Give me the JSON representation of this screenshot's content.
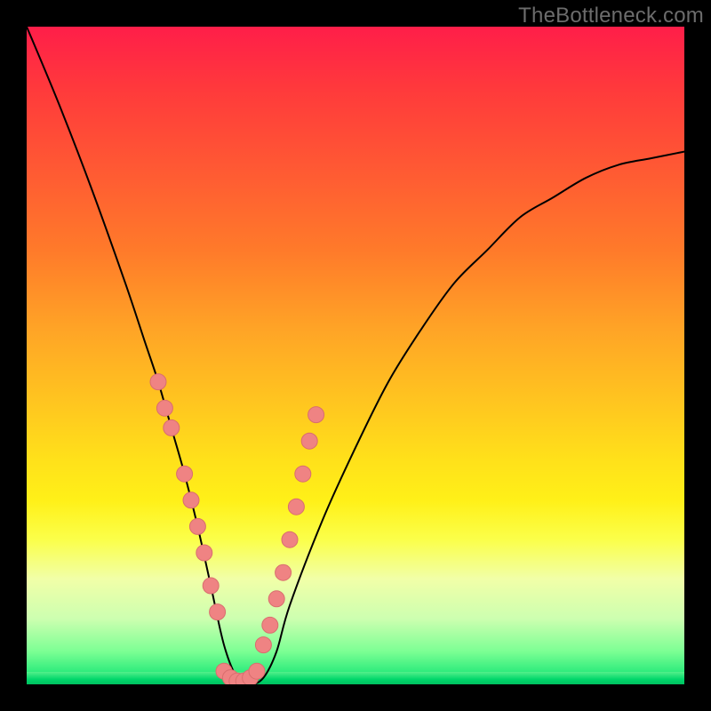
{
  "watermark": "TheBottleneck.com",
  "colors": {
    "background": "#000000",
    "gradient_top": "#ff1e49",
    "gradient_bottom": "#00e06e",
    "curve": "#000000",
    "marker": "#ef8383"
  },
  "chart_data": {
    "type": "line",
    "title": "",
    "xlabel": "",
    "ylabel": "",
    "xlim": [
      0,
      100
    ],
    "ylim": [
      0,
      100
    ],
    "grid": false,
    "legend": false,
    "x": [
      0,
      5,
      10,
      15,
      18,
      20,
      22,
      24,
      26,
      28,
      30,
      32,
      34,
      36,
      38,
      40,
      45,
      50,
      55,
      60,
      65,
      70,
      75,
      80,
      85,
      90,
      95,
      100
    ],
    "values": [
      100,
      88,
      75,
      61,
      52,
      46,
      39,
      32,
      24,
      15,
      6,
      1,
      0,
      1,
      5,
      12,
      25,
      36,
      46,
      54,
      61,
      66,
      71,
      74,
      77,
      79,
      80,
      81
    ],
    "annotations": [],
    "markers_left": [
      {
        "x": 20,
        "y": 46
      },
      {
        "x": 21,
        "y": 42
      },
      {
        "x": 22,
        "y": 39
      },
      {
        "x": 24,
        "y": 32
      },
      {
        "x": 25,
        "y": 28
      },
      {
        "x": 26,
        "y": 24
      },
      {
        "x": 27,
        "y": 20
      },
      {
        "x": 28,
        "y": 15
      },
      {
        "x": 29,
        "y": 11
      }
    ],
    "markers_right": [
      {
        "x": 36,
        "y": 6
      },
      {
        "x": 37,
        "y": 9
      },
      {
        "x": 38,
        "y": 13
      },
      {
        "x": 39,
        "y": 17
      },
      {
        "x": 40,
        "y": 22
      },
      {
        "x": 41,
        "y": 27
      },
      {
        "x": 42,
        "y": 32
      },
      {
        "x": 43,
        "y": 37
      },
      {
        "x": 44,
        "y": 41
      }
    ],
    "valley_floor": [
      {
        "x": 30,
        "y": 2
      },
      {
        "x": 31,
        "y": 1
      },
      {
        "x": 32,
        "y": 0.5
      },
      {
        "x": 33,
        "y": 0.5
      },
      {
        "x": 34,
        "y": 1
      },
      {
        "x": 35,
        "y": 2
      }
    ]
  }
}
